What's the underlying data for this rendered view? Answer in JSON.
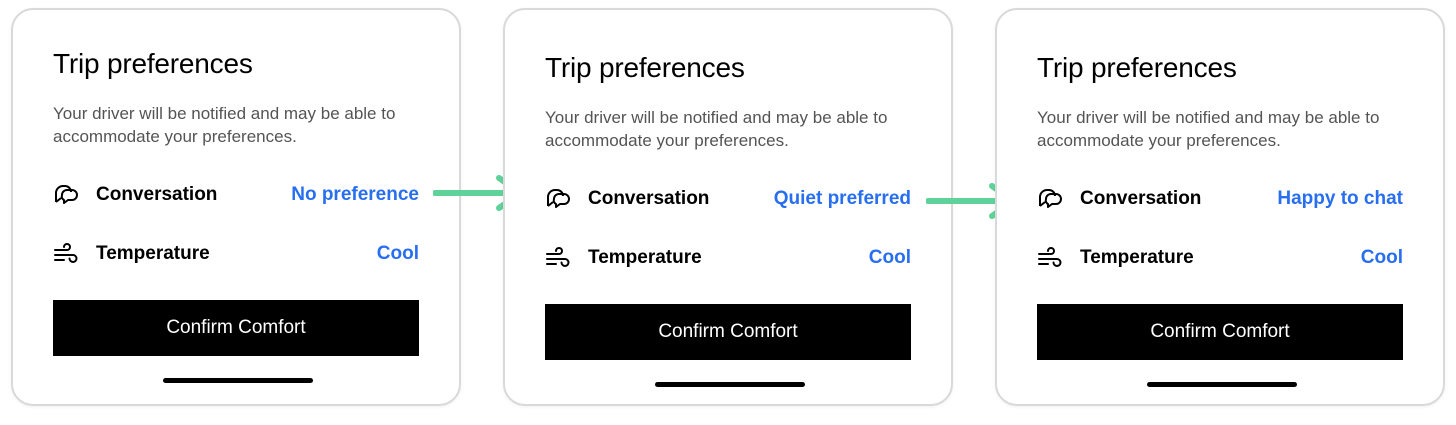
{
  "colors": {
    "accent": "#276ef1",
    "arrow": "#5fd29a",
    "button_bg": "#000000"
  },
  "cards": [
    {
      "title": "Trip preferences",
      "description": "Your driver will be notified and may be able to accommodate your preferences.",
      "conversation": {
        "label": "Conversation",
        "value": "No preference",
        "icon": "chat-bubbles-icon"
      },
      "temperature": {
        "label": "Temperature",
        "value": "Cool",
        "icon": "wind-icon"
      },
      "button": "Confirm Comfort"
    },
    {
      "title": "Trip preferences",
      "description": "Your driver will be notified and may be able to accommodate your preferences.",
      "conversation": {
        "label": "Conversation",
        "value": "Quiet preferred",
        "icon": "chat-bubbles-icon"
      },
      "temperature": {
        "label": "Temperature",
        "value": "Cool",
        "icon": "wind-icon"
      },
      "button": "Confirm Comfort"
    },
    {
      "title": "Trip preferences",
      "description": "Your driver will be notified and may be able to accommodate your preferences.",
      "conversation": {
        "label": "Conversation",
        "value": "Happy to chat",
        "icon": "chat-bubbles-icon"
      },
      "temperature": {
        "label": "Temperature",
        "value": "Cool",
        "icon": "wind-icon"
      },
      "button": "Confirm Comfort"
    }
  ]
}
